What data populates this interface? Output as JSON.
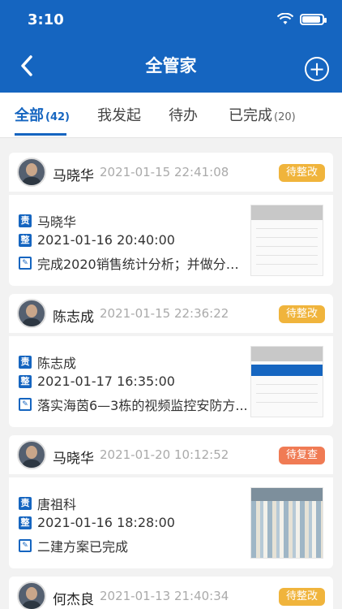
{
  "status": {
    "time": "3:10"
  },
  "header": {
    "title": "全管家"
  },
  "tabs": [
    {
      "label": "全部",
      "count": "(42)"
    },
    {
      "label": "我发起",
      "count": ""
    },
    {
      "label": "待办",
      "count": ""
    },
    {
      "label": "已完成",
      "count": "(20)"
    }
  ],
  "cards": [
    {
      "name": "马晓华",
      "time": "2021-01-15 22:41:08",
      "status": "待整改",
      "responsible": "马晓华",
      "deadline": "2021-01-16 20:40:00",
      "desc": "完成2020销售统计分析；并做分析..."
    },
    {
      "name": "陈志成",
      "time": "2021-01-15 22:36:22",
      "status": "待整改",
      "responsible": "陈志成",
      "deadline": "2021-01-17 16:35:00",
      "desc": "落实海茵6—3栋的视频监控安防方..."
    },
    {
      "name": "马晓华",
      "time": "2021-01-20 10:12:52",
      "status": "待复查",
      "responsible": "唐祖科",
      "deadline": "2021-01-16 18:28:00",
      "desc": "二建方案已完成"
    },
    {
      "name": "何杰良",
      "time": "2021-01-13 21:40:34",
      "status": "待整改"
    }
  ],
  "icons": {
    "responsible": "责",
    "deadline": "整",
    "desc": "✎"
  },
  "colors": {
    "primary": "#1565c0",
    "badge_orange": "#f0b43c",
    "badge_red": "#f07b54"
  }
}
